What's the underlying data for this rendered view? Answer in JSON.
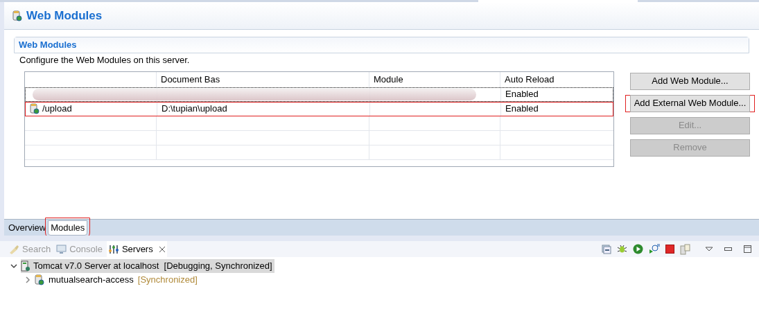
{
  "editor": {
    "title": "Web Modules",
    "section": {
      "title": "Web Modules",
      "description": "Configure the Web Modules on this server.",
      "table": {
        "columns": [
          "",
          "Document Bas",
          "Module",
          "Auto Reload"
        ],
        "rows": [
          {
            "kind": "redacted",
            "cells": [
              "",
              "",
              "",
              "Enabled"
            ],
            "focused": true,
            "highlighted": false
          },
          {
            "kind": "module",
            "cells": [
              "/upload",
              "D:\\tupian\\upload",
              "",
              "Enabled"
            ],
            "focused": false,
            "highlighted": true
          }
        ]
      },
      "buttons": [
        {
          "label": "Add Web Module...",
          "disabled": false,
          "highlighted": false
        },
        {
          "label": "Add External Web Module...",
          "disabled": false,
          "highlighted": true
        },
        {
          "label": "Edit...",
          "disabled": true,
          "highlighted": false
        },
        {
          "label": "Remove",
          "disabled": true,
          "highlighted": false
        }
      ]
    },
    "tabs": [
      {
        "label": "Overview",
        "selected": false,
        "highlighted": false
      },
      {
        "label": "Modules",
        "selected": true,
        "highlighted": true
      }
    ]
  },
  "views": {
    "tabs": [
      {
        "kind": "search",
        "label": "Search",
        "selected": false
      },
      {
        "kind": "console",
        "label": "Console",
        "selected": false
      },
      {
        "kind": "servers",
        "label": "Servers",
        "selected": true
      }
    ],
    "tree": [
      {
        "label": "Tomcat v7.0 Server at localhost",
        "status": "[Debugging, Synchronized]",
        "expanded": true,
        "selected": true,
        "children": [
          {
            "label": "mutualsearch-access",
            "status": "[Synchronized]",
            "expanded": false,
            "selected": false
          }
        ]
      }
    ]
  }
}
